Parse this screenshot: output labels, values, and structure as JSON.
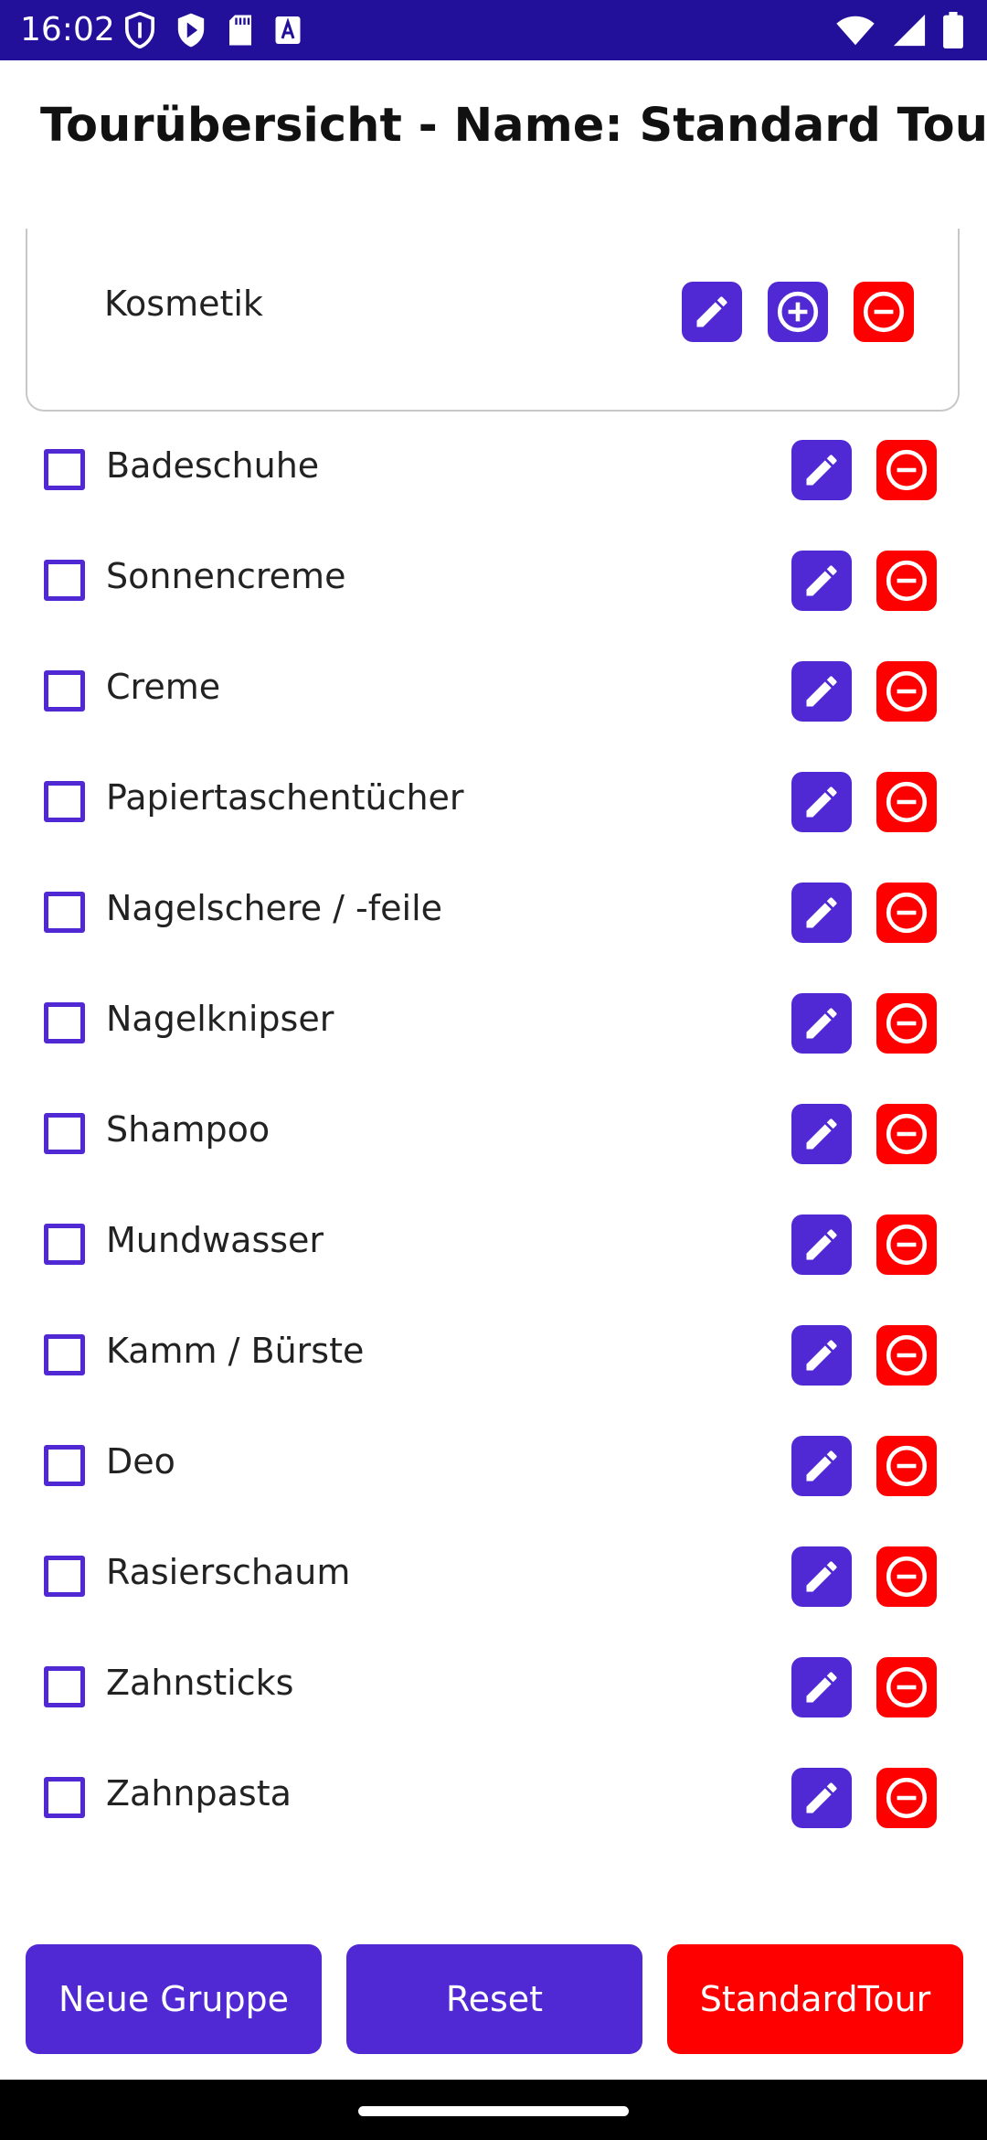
{
  "status_bar": {
    "time": "16:02",
    "icons_left": [
      "shield-check-icon",
      "play-protect-icon",
      "sd-card-icon",
      "font-a-icon"
    ],
    "icons_right": [
      "wifi-icon",
      "signal-icon",
      "battery-icon"
    ]
  },
  "header": {
    "title": "Tourübersicht - Name: Standard Tour"
  },
  "group": {
    "name": "Kosmetik"
  },
  "items": [
    {
      "label": "Badeschuhe",
      "checked": false
    },
    {
      "label": "Sonnencreme",
      "checked": false
    },
    {
      "label": "Creme",
      "checked": false
    },
    {
      "label": "Papiertaschentücher",
      "checked": false
    },
    {
      "label": "Nagelschere / -feile",
      "checked": false
    },
    {
      "label": "Nagelknipser",
      "checked": false
    },
    {
      "label": "Shampoo",
      "checked": false
    },
    {
      "label": "Mundwasser",
      "checked": false
    },
    {
      "label": "Kamm / Bürste",
      "checked": false
    },
    {
      "label": "Deo",
      "checked": false
    },
    {
      "label": "Rasierschaum",
      "checked": false
    },
    {
      "label": "Zahnsticks",
      "checked": false
    },
    {
      "label": "Zahnpasta",
      "checked": false
    }
  ],
  "bottom_buttons": {
    "new_group": "Neue Gruppe",
    "reset": "Reset",
    "standard_tour": "StandardTour"
  },
  "colors": {
    "status_bar": "#22109a",
    "primary": "#5029d4",
    "danger": "#ff0000"
  }
}
